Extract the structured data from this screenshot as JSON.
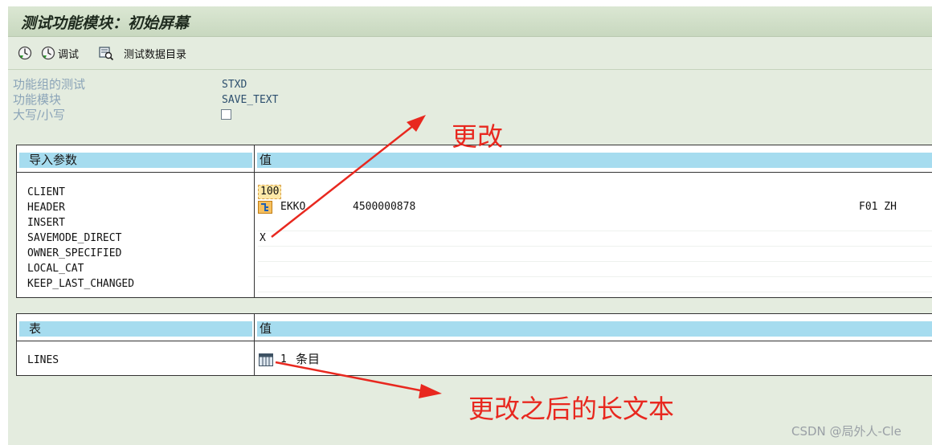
{
  "window": {
    "title": "测试功能模块：初始屏幕"
  },
  "toolbar": {
    "items": [
      {
        "icon": "execute-icon",
        "label": ""
      },
      {
        "icon": "debug-icon",
        "label": "调试"
      },
      {
        "icon": "test-data-directory-icon",
        "label": "测试数据目录"
      }
    ]
  },
  "fields": [
    {
      "label": "功能组的测试",
      "value": "STXD"
    },
    {
      "label": "功能模块",
      "value": "SAVE_TEXT"
    },
    {
      "label": "大写/小写",
      "value": ""
    }
  ],
  "import_params": {
    "header_name": "导入参数",
    "header_value": "值",
    "rows": [
      {
        "name": "CLIENT",
        "value": "100"
      },
      {
        "name": "HEADER",
        "value": "EKKO",
        "value2": "4500000878",
        "value3": "F01 ZH"
      },
      {
        "name": "INSERT",
        "value": ""
      },
      {
        "name": "SAVEMODE_DIRECT",
        "value": "X"
      },
      {
        "name": "OWNER_SPECIFIED",
        "value": ""
      },
      {
        "name": "LOCAL_CAT",
        "value": ""
      },
      {
        "name": "KEEP_LAST_CHANGED",
        "value": ""
      }
    ]
  },
  "tables": {
    "header_name": "表",
    "header_value": "值",
    "rows": [
      {
        "name": "LINES",
        "count": "1",
        "unit": "条目"
      }
    ]
  },
  "annotations": {
    "change": "更改",
    "after_change": "更改之后的长文本"
  },
  "watermark": "CSDN @局外人-Cle",
  "colors": {
    "header_band": "#a6dcef",
    "annotation": "#e8281f",
    "background": "#e4ecdf"
  }
}
